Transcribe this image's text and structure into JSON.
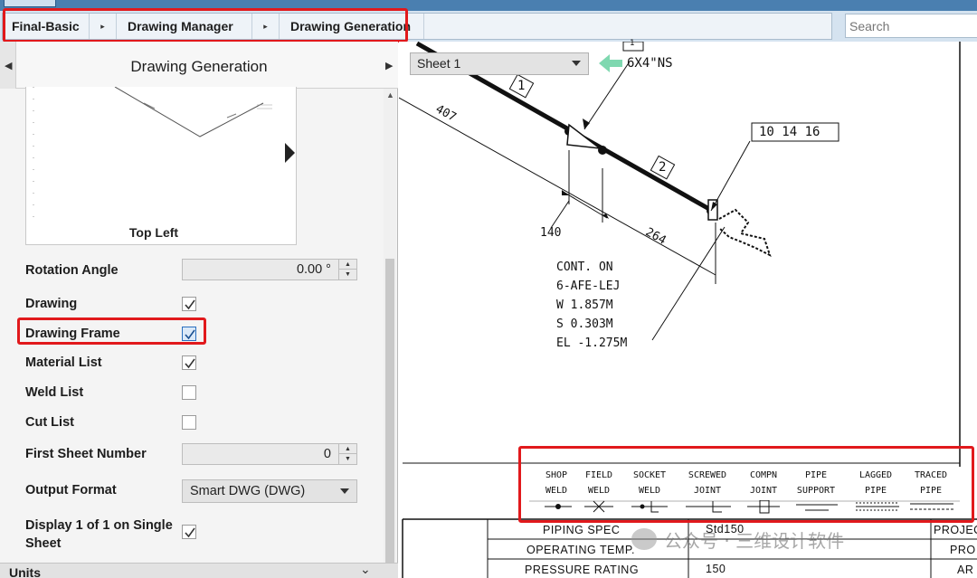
{
  "breadcrumb": {
    "items": [
      "Final-Basic",
      "Drawing Manager",
      "Drawing Generation"
    ],
    "separator": "▸"
  },
  "search": {
    "placeholder": "Search"
  },
  "panel": {
    "title": "Drawing Generation",
    "preview_caption": "Top Left",
    "fields": {
      "rotation_angle": {
        "label": "Rotation Angle",
        "value": "0.00 °"
      },
      "drawing": {
        "label": "Drawing",
        "checked": true
      },
      "drawing_frame": {
        "label": "Drawing Frame",
        "checked": true
      },
      "material_list": {
        "label": "Material List",
        "checked": true
      },
      "weld_list": {
        "label": "Weld List",
        "checked": false
      },
      "cut_list": {
        "label": "Cut List",
        "checked": false
      },
      "first_sheet_number": {
        "label": "First Sheet Number",
        "value": "0"
      },
      "output_format": {
        "label": "Output Format",
        "value": "Smart DWG (DWG)"
      },
      "display_single": {
        "label": "Display 1 of 1 on Single Sheet",
        "checked": true
      }
    },
    "units_label": "Units"
  },
  "drawing_view": {
    "sheet_select": "Sheet 1",
    "pipe_size": "6X4\"NS",
    "top_tag": "1",
    "segment_tags": [
      "1",
      "2"
    ],
    "coords_box": "10 14 16",
    "dims": [
      "407",
      "140",
      "264"
    ],
    "annotation": [
      "CONT. ON",
      "6-AFE-LEJ",
      "W 1.857M",
      "S 0.303M",
      "EL -1.275M"
    ],
    "legend": [
      {
        "top": "SHOP",
        "bottom": "WELD"
      },
      {
        "top": "FIELD",
        "bottom": "WELD"
      },
      {
        "top": "SOCKET",
        "bottom": "WELD"
      },
      {
        "top": "SCREWED",
        "bottom": "JOINT"
      },
      {
        "top": "COMPN",
        "bottom": "JOINT"
      },
      {
        "top": "PIPE",
        "bottom": "SUPPORT"
      },
      {
        "top": "LAGGED",
        "bottom": "PIPE"
      },
      {
        "top": "TRACED",
        "bottom": "PIPE"
      }
    ],
    "title_block": {
      "piping_spec": {
        "label": "PIPING SPEC",
        "value": "Std150"
      },
      "operating_temp": {
        "label": "OPERATING TEMP."
      },
      "pressure_rating": {
        "label": "PRESSURE RATING",
        "value": "150"
      },
      "right_cells": [
        "PROJEC",
        "PRO",
        "AR"
      ]
    }
  },
  "watermark": "公众号 · 三维设计软件",
  "colors": {
    "highlight": "#e1191c",
    "accent": "#2a6fbf",
    "back_arrow": "#7fd8b0"
  }
}
